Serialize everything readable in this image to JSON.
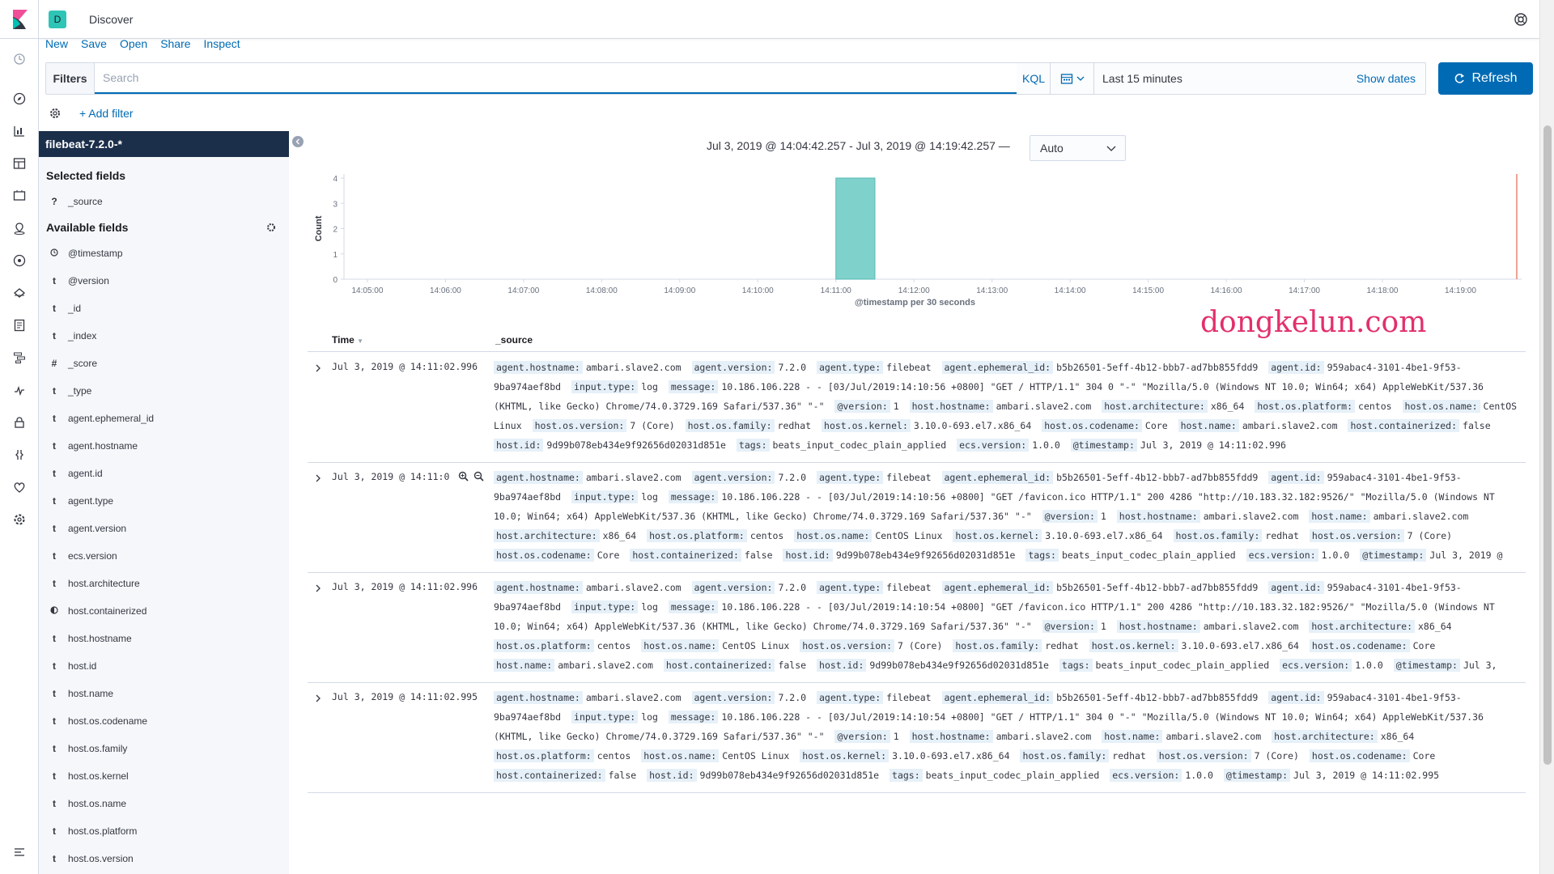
{
  "header": {
    "space_initial": "D",
    "app_title": "Discover"
  },
  "topmenu": {
    "new": "New",
    "save": "Save",
    "open": "Open",
    "share": "Share",
    "inspect": "Inspect"
  },
  "query": {
    "filters_label": "Filters",
    "placeholder": "Search",
    "kql": "KQL"
  },
  "datepicker": {
    "range": "Last 15 minutes",
    "show_dates": "Show dates"
  },
  "refresh": {
    "label": "Refresh"
  },
  "filterbar": {
    "add_filter": "+ Add filter"
  },
  "sidebar": {
    "index_pattern": "filebeat-7.2.0-*",
    "selected_title": "Selected fields",
    "selected": [
      {
        "type": "?",
        "name": "_source"
      }
    ],
    "available_title": "Available fields",
    "available": [
      {
        "type": "clock",
        "name": "@timestamp"
      },
      {
        "type": "t",
        "name": "@version"
      },
      {
        "type": "t",
        "name": "_id"
      },
      {
        "type": "t",
        "name": "_index"
      },
      {
        "type": "#",
        "name": "_score"
      },
      {
        "type": "t",
        "name": "_type"
      },
      {
        "type": "t",
        "name": "agent.ephemeral_id"
      },
      {
        "type": "t",
        "name": "agent.hostname"
      },
      {
        "type": "t",
        "name": "agent.id"
      },
      {
        "type": "t",
        "name": "agent.type"
      },
      {
        "type": "t",
        "name": "agent.version"
      },
      {
        "type": "t",
        "name": "ecs.version"
      },
      {
        "type": "t",
        "name": "host.architecture"
      },
      {
        "type": "bool",
        "name": "host.containerized"
      },
      {
        "type": "t",
        "name": "host.hostname"
      },
      {
        "type": "t",
        "name": "host.id"
      },
      {
        "type": "t",
        "name": "host.name"
      },
      {
        "type": "t",
        "name": "host.os.codename"
      },
      {
        "type": "t",
        "name": "host.os.family"
      },
      {
        "type": "t",
        "name": "host.os.kernel"
      },
      {
        "type": "t",
        "name": "host.os.name"
      },
      {
        "type": "t",
        "name": "host.os.platform"
      },
      {
        "type": "t",
        "name": "host.os.version"
      }
    ]
  },
  "main": {
    "time_range_text": "Jul 3, 2019 @ 14:04:42.257 - Jul 3, 2019 @ 14:19:42.257 —",
    "interval": "Auto",
    "watermark": "dongkelun.com"
  },
  "chart_data": {
    "type": "bar",
    "ylabel": "Count",
    "xlabel": "@timestamp per 30 seconds",
    "ylim": [
      0,
      4
    ],
    "yticks": [
      "0",
      "1",
      "2",
      "3",
      "4"
    ],
    "xticks": [
      "14:05:00",
      "14:06:00",
      "14:07:00",
      "14:08:00",
      "14:09:00",
      "14:10:00",
      "14:11:00",
      "14:12:00",
      "14:13:00",
      "14:14:00",
      "14:15:00",
      "14:16:00",
      "14:17:00",
      "14:18:00",
      "14:19:00"
    ],
    "bars": [
      {
        "x_start": "14:11:00",
        "x_end": "14:11:30",
        "value": 4
      }
    ],
    "bar_color": "#7fd1cc",
    "current_time_color": "#e7664c",
    "grid": false
  },
  "table": {
    "col_time": "Time",
    "col_source": "_source",
    "rows": [
      {
        "time": "Jul 3, 2019 @ 14:11:02.996",
        "fields": [
          [
            "agent.hostname:",
            "ambari.slave2.com"
          ],
          [
            "agent.version:",
            "7.2.0"
          ],
          [
            "agent.type:",
            "filebeat"
          ],
          [
            "agent.ephemeral_id:",
            "b5b26501-5eff-4b12-bbb7-ad7bb855fdd9"
          ],
          [
            "agent.id:",
            "959abac4-3101-4be1-9f53-9ba974aef8bd"
          ],
          [
            "input.type:",
            "log"
          ],
          [
            "message:",
            "10.186.106.228 - - [03/Jul/2019:14:10:56 +0800] \"GET / HTTP/1.1\" 304 0 \"-\" \"Mozilla/5.0 (Windows NT 10.0; Win64; x64) AppleWebKit/537.36 (KHTML, like Gecko) Chrome/74.0.3729.169 Safari/537.36\" \"-\""
          ],
          [
            "@version:",
            "1"
          ],
          [
            "host.hostname:",
            "ambari.slave2.com"
          ],
          [
            "host.architecture:",
            "x86_64"
          ],
          [
            "host.os.platform:",
            "centos"
          ],
          [
            "host.os.name:",
            "CentOS Linux"
          ],
          [
            "host.os.version:",
            "7 (Core)"
          ],
          [
            "host.os.family:",
            "redhat"
          ],
          [
            "host.os.kernel:",
            "3.10.0-693.el7.x86_64"
          ],
          [
            "host.os.codename:",
            "Core"
          ],
          [
            "host.name:",
            "ambari.slave2.com"
          ],
          [
            "host.containerized:",
            "false"
          ],
          [
            "host.id:",
            "9d99b078eb434e9f92656d02031d851e"
          ],
          [
            "tags:",
            "beats_input_codec_plain_applied"
          ],
          [
            "ecs.version:",
            "1.0.0"
          ],
          [
            "@timestamp:",
            "Jul 3, 2019 @ 14:11:02.996"
          ]
        ]
      },
      {
        "time": "Jul 3, 2019 @ 14:11:0",
        "fields": [
          [
            "agent.hostname:",
            "ambari.slave2.com"
          ],
          [
            "agent.version:",
            "7.2.0"
          ],
          [
            "agent.type:",
            "filebeat"
          ],
          [
            "agent.ephemeral_id:",
            "b5b26501-5eff-4b12-bbb7-ad7bb855fdd9"
          ],
          [
            "agent.id:",
            "959abac4-3101-4be1-9f53-9ba974aef8bd"
          ],
          [
            "input.type:",
            "log"
          ],
          [
            "message:",
            "10.186.106.228 - - [03/Jul/2019:14:10:56 +0800] \"GET /favicon.ico HTTP/1.1\" 200 4286 \"http://10.183.32.182:9526/\" \"Mozilla/5.0 (Windows NT 10.0; Win64; x64) AppleWebKit/537.36 (KHTML, like Gecko) Chrome/74.0.3729.169 Safari/537.36\" \"-\""
          ],
          [
            "@version:",
            "1"
          ],
          [
            "host.hostname:",
            "ambari.slave2.com"
          ],
          [
            "host.name:",
            "ambari.slave2.com"
          ],
          [
            "host.architecture:",
            "x86_64"
          ],
          [
            "host.os.platform:",
            "centos"
          ],
          [
            "host.os.name:",
            "CentOS Linux"
          ],
          [
            "host.os.kernel:",
            "3.10.0-693.el7.x86_64"
          ],
          [
            "host.os.family:",
            "redhat"
          ],
          [
            "host.os.version:",
            "7 (Core)"
          ],
          [
            "host.os.codename:",
            "Core"
          ],
          [
            "host.containerized:",
            "false"
          ],
          [
            "host.id:",
            "9d99b078eb434e9f92656d02031d851e"
          ],
          [
            "tags:",
            "beats_input_codec_plain_applied"
          ],
          [
            "ecs.version:",
            "1.0.0"
          ],
          [
            "@timestamp:",
            "Jul 3, 2019 @"
          ]
        ]
      },
      {
        "time": "Jul 3, 2019 @ 14:11:02.996",
        "fields": [
          [
            "agent.hostname:",
            "ambari.slave2.com"
          ],
          [
            "agent.version:",
            "7.2.0"
          ],
          [
            "agent.type:",
            "filebeat"
          ],
          [
            "agent.ephemeral_id:",
            "b5b26501-5eff-4b12-bbb7-ad7bb855fdd9"
          ],
          [
            "agent.id:",
            "959abac4-3101-4be1-9f53-9ba974aef8bd"
          ],
          [
            "input.type:",
            "log"
          ],
          [
            "message:",
            "10.186.106.228 - - [03/Jul/2019:14:10:54 +0800] \"GET /favicon.ico HTTP/1.1\" 200 4286 \"http://10.183.32.182:9526/\" \"Mozilla/5.0 (Windows NT 10.0; Win64; x64) AppleWebKit/537.36 (KHTML, like Gecko) Chrome/74.0.3729.169 Safari/537.36\" \"-\""
          ],
          [
            "@version:",
            "1"
          ],
          [
            "host.hostname:",
            "ambari.slave2.com"
          ],
          [
            "host.architecture:",
            "x86_64"
          ],
          [
            "host.os.platform:",
            "centos"
          ],
          [
            "host.os.name:",
            "CentOS Linux"
          ],
          [
            "host.os.version:",
            "7 (Core)"
          ],
          [
            "host.os.family:",
            "redhat"
          ],
          [
            "host.os.kernel:",
            "3.10.0-693.el7.x86_64"
          ],
          [
            "host.os.codename:",
            "Core"
          ],
          [
            "host.name:",
            "ambari.slave2.com"
          ],
          [
            "host.containerized:",
            "false"
          ],
          [
            "host.id:",
            "9d99b078eb434e9f92656d02031d851e"
          ],
          [
            "tags:",
            "beats_input_codec_plain_applied"
          ],
          [
            "ecs.version:",
            "1.0.0"
          ],
          [
            "@timestamp:",
            "Jul 3,"
          ]
        ]
      },
      {
        "time": "Jul 3, 2019 @ 14:11:02.995",
        "fields": [
          [
            "agent.hostname:",
            "ambari.slave2.com"
          ],
          [
            "agent.version:",
            "7.2.0"
          ],
          [
            "agent.type:",
            "filebeat"
          ],
          [
            "agent.ephemeral_id:",
            "b5b26501-5eff-4b12-bbb7-ad7bb855fdd9"
          ],
          [
            "agent.id:",
            "959abac4-3101-4be1-9f53-9ba974aef8bd"
          ],
          [
            "input.type:",
            "log"
          ],
          [
            "message:",
            "10.186.106.228 - - [03/Jul/2019:14:10:54 +0800] \"GET / HTTP/1.1\" 304 0 \"-\" \"Mozilla/5.0 (Windows NT 10.0; Win64; x64) AppleWebKit/537.36 (KHTML, like Gecko) Chrome/74.0.3729.169 Safari/537.36\" \"-\""
          ],
          [
            "@version:",
            "1"
          ],
          [
            "host.hostname:",
            "ambari.slave2.com"
          ],
          [
            "host.name:",
            "ambari.slave2.com"
          ],
          [
            "host.architecture:",
            "x86_64"
          ],
          [
            "host.os.platform:",
            "centos"
          ],
          [
            "host.os.name:",
            "CentOS Linux"
          ],
          [
            "host.os.kernel:",
            "3.10.0-693.el7.x86_64"
          ],
          [
            "host.os.family:",
            "redhat"
          ],
          [
            "host.os.version:",
            "7 (Core)"
          ],
          [
            "host.os.codename:",
            "Core"
          ],
          [
            "host.containerized:",
            "false"
          ],
          [
            "host.id:",
            "9d99b078eb434e9f92656d02031d851e"
          ],
          [
            "tags:",
            "beats_input_codec_plain_applied"
          ],
          [
            "ecs.version:",
            "1.0.0"
          ],
          [
            "@timestamp:",
            "Jul 3, 2019 @ 14:11:02.995"
          ]
        ]
      }
    ]
  }
}
